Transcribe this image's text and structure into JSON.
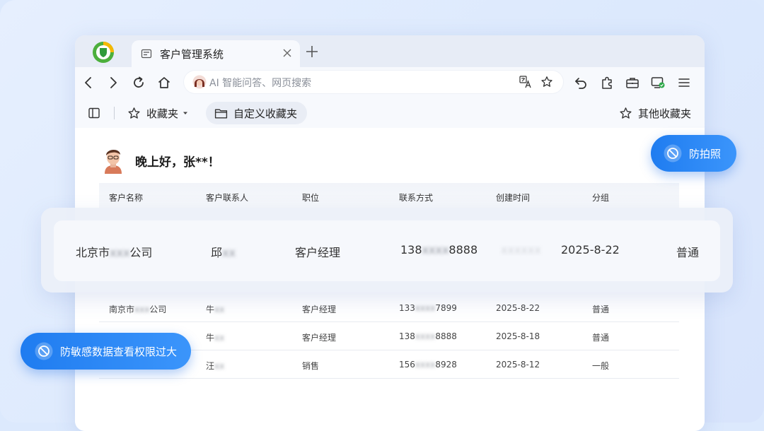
{
  "browser": {
    "tab": {
      "title": "客户管理系统"
    },
    "omnibox": {
      "placeholder": "AI 智能问答、网页搜索"
    },
    "bookmarks": {
      "favorites_label": "收藏夹",
      "custom_folder_label": "自定义收藏夹",
      "other_label": "其他收藏夹"
    }
  },
  "page": {
    "greeting": "晚上好，张**！",
    "columns": [
      "客户名称",
      "客户联系人",
      "职位",
      "联系方式",
      "创建时间",
      "分组"
    ],
    "highlight_row": {
      "company_prefix": "北京市",
      "company_masked": "xxx",
      "company_suffix": "公司",
      "contact_prefix": "邱",
      "contact_masked": "xx",
      "position": "客户经理",
      "phone_prefix": "138",
      "phone_masked": "xxxx",
      "phone_suffix": "8888",
      "created_masked": "xxxxxx",
      "date": "2025-8-22",
      "group": "普通"
    },
    "rows": [
      {
        "company_prefix": "南京市",
        "company_masked": "xxx",
        "company_suffix": "公司",
        "contact_prefix": "牛",
        "contact_masked": "xx",
        "position": "客户经理",
        "phone_prefix": "133",
        "phone_masked": "xxxx",
        "phone_suffix": "7899",
        "date": "2025-8-22",
        "group": "普通"
      },
      {
        "contact_prefix": "牛",
        "contact_masked": "xx",
        "position": "客户经理",
        "phone_prefix": "138",
        "phone_masked": "xxxx",
        "phone_suffix": "8888",
        "date": "2025-8-18",
        "group": "普通"
      },
      {
        "contact_prefix": "汪",
        "contact_masked": "xx",
        "position": "销售",
        "phone_prefix": "156",
        "phone_masked": "xxxx",
        "phone_suffix": "8928",
        "date": "2025-8-12",
        "group": "一般"
      }
    ]
  },
  "badges": {
    "anti_photo": "防拍照",
    "anti_sensitive": "防敏感数据查看权限过大"
  },
  "colors": {
    "accent": "#2a86f6",
    "background": "#dce9fd"
  }
}
